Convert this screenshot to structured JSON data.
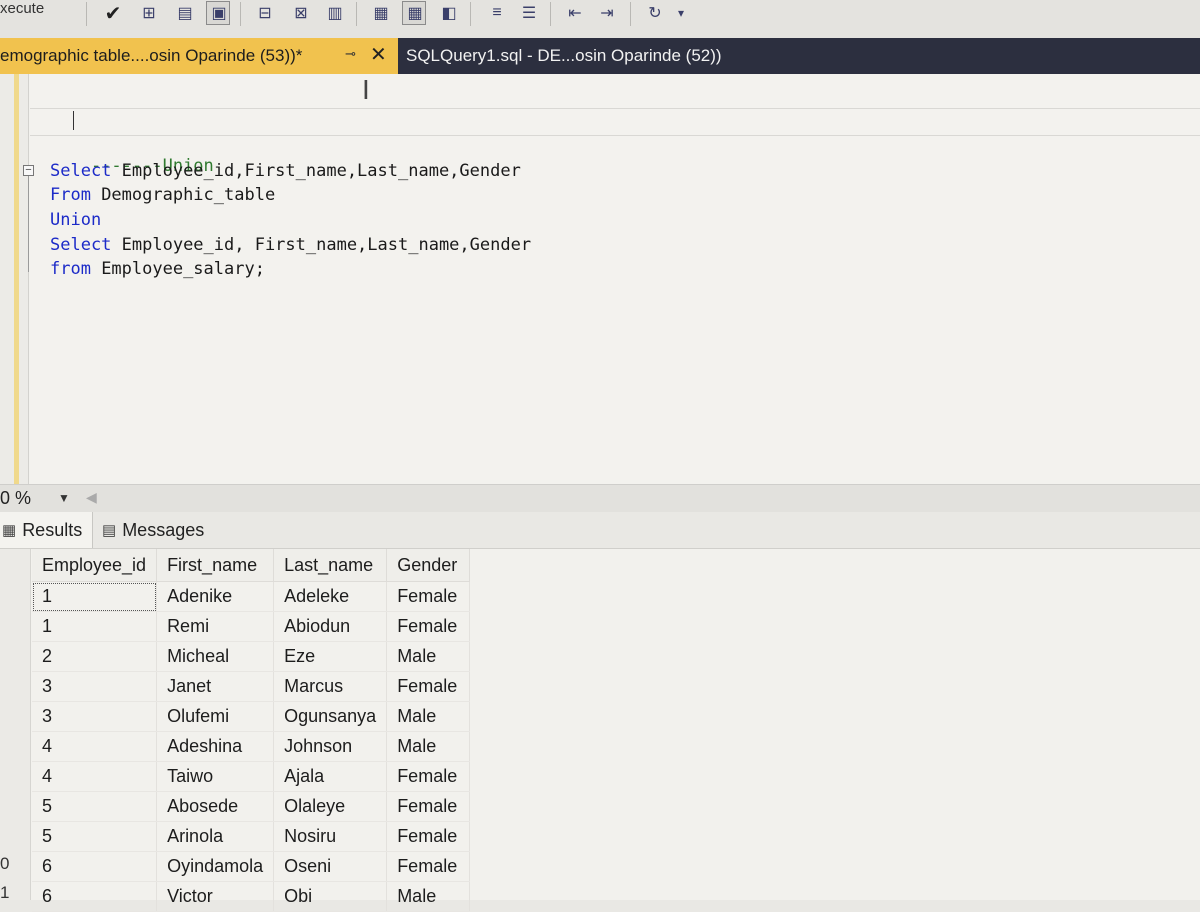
{
  "toolbar": {
    "execute_label": "xecute",
    "icons": [
      "parse-check-icon",
      "display-plan-icon",
      "query-options-icon",
      "results-to-text-icon",
      "results-to-grid-icon",
      "comment-icon",
      "uncomment-icon",
      "outdent-icon",
      "indent-icon",
      "specify-values-icon"
    ]
  },
  "tabs": [
    {
      "title": "emographic table....osin Oparinde (53))*",
      "active": true
    },
    {
      "title": "SQLQuery1.sql - DE...osin Oparinde (52))",
      "active": false
    }
  ],
  "editor": {
    "lines": [
      {
        "type": "comment",
        "text": "-------Union"
      },
      {
        "type": "code",
        "kw": "Select",
        "rest": " Employee_id,First_name,Last_name,Gender"
      },
      {
        "type": "code",
        "kw": "From",
        "rest": " Demographic_table"
      },
      {
        "type": "code",
        "kw": "Union",
        "rest": ""
      },
      {
        "type": "code",
        "kw": "Select",
        "rest": " Employee_id, First_name,Last_name,Gender"
      },
      {
        "type": "code",
        "kw": "from",
        "rest": " Employee_salary;"
      }
    ]
  },
  "zoom": {
    "value": "0 %"
  },
  "results_tabs": {
    "results": "Results",
    "messages": "Messages"
  },
  "grid": {
    "columns": [
      "Employee_id",
      "First_name",
      "Last_name",
      "Gender"
    ],
    "row_numbers": [
      "",
      "",
      "",
      "",
      "",
      "",
      "",
      "",
      "",
      "0",
      "1"
    ],
    "rows": [
      [
        "1",
        "Adenike",
        "Adeleke",
        "Female"
      ],
      [
        "1",
        "Remi",
        "Abiodun",
        "Female"
      ],
      [
        "2",
        "Micheal",
        "Eze",
        "Male"
      ],
      [
        "3",
        "Janet",
        "Marcus",
        "Female"
      ],
      [
        "3",
        "Olufemi",
        "Ogunsanya",
        "Male"
      ],
      [
        "4",
        "Adeshina",
        "Johnson",
        "Male"
      ],
      [
        "4",
        "Taiwo",
        "Ajala",
        "Female"
      ],
      [
        "5",
        "Abosede",
        "Olaleye",
        "Female"
      ],
      [
        "5",
        "Arinola",
        "Nosiru",
        "Female"
      ],
      [
        "6",
        "Oyindamola",
        "Oseni",
        "Female"
      ],
      [
        "6",
        "Victor",
        "Obi",
        "Male"
      ]
    ]
  }
}
